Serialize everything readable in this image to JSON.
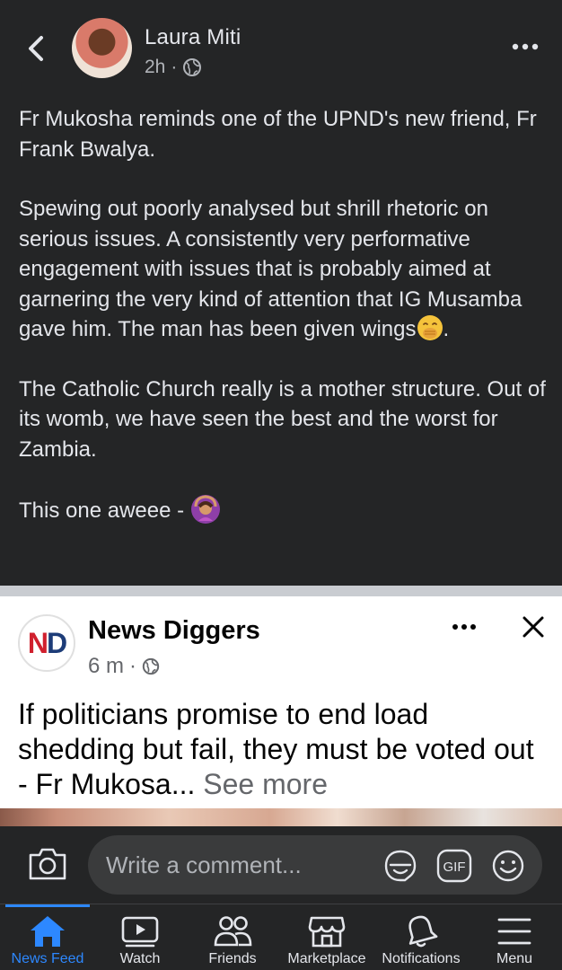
{
  "post": {
    "author": "Laura Miti",
    "time": "2h",
    "separator": "·",
    "paragraphs": {
      "p1": "Fr Mukosha reminds one of the UPND's new friend, Fr Frank Bwalya.",
      "p2": "Spewing out poorly analysed but shrill rhetoric on serious issues. A consistently very performative engagement with issues that is probably aimed at garnering the very kind of attention that IG Musamba gave him. The man has been given wings",
      "p2_end": ".",
      "p3": "The Catholic Church really is a mother structure. Out of its womb, we have seen the best and the worst for Zambia.",
      "p4": "This one aweee -"
    },
    "emojis": {
      "p2": "face-with-hand-over-mouth",
      "p4": "woman-gesturing-ok"
    }
  },
  "shared": {
    "logo_letters": {
      "n": "N",
      "d": "D"
    },
    "author": "News Diggers",
    "time": "6 m",
    "separator": "·",
    "text": "If politicians promise to end load shedding but fail, they must be voted out - Fr Mukosa...",
    "see_more": "See more"
  },
  "comment": {
    "placeholder": "Write a comment...",
    "gif_label": "GIF"
  },
  "tabs": [
    {
      "label": "News Feed",
      "icon": "home-icon",
      "active": true
    },
    {
      "label": "Watch",
      "icon": "watch-icon",
      "active": false
    },
    {
      "label": "Friends",
      "icon": "friends-icon",
      "active": false
    },
    {
      "label": "Marketplace",
      "icon": "marketplace-icon",
      "active": false
    },
    {
      "label": "Notifications",
      "icon": "bell-icon",
      "active": false
    },
    {
      "label": "Menu",
      "icon": "menu-icon",
      "active": false
    }
  ],
  "colors": {
    "background": "#242526",
    "text": "#e4e6eb",
    "secondary_text": "#b0b3b8",
    "accent": "#2d88ff",
    "card_background": "#ffffff",
    "logo_red": "#d0202e",
    "logo_blue": "#1d3c78"
  }
}
